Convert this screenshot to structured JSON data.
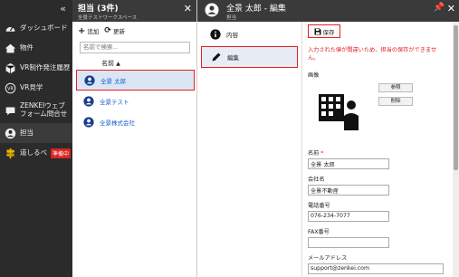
{
  "sidebar": {
    "collapse_glyph": "«",
    "items": [
      {
        "label": "ダッシュボード",
        "icon": "speedometer-icon"
      },
      {
        "label": "物件",
        "icon": "building-icon"
      },
      {
        "label": "VR制作発注履歴",
        "icon": "vr-headset-icon"
      },
      {
        "label": "VR見学",
        "icon": "vr-badge-icon"
      },
      {
        "label": "ZENKEIウェブ\nフォーム問合せ",
        "icon": "chat-icon"
      },
      {
        "label": "担当",
        "icon": "person-icon",
        "active": true
      },
      {
        "label": "道しるべ",
        "icon": "signpost-icon",
        "badge": "準備中"
      }
    ]
  },
  "list_panel": {
    "title": "担当 (3件)",
    "subtitle": "全景テストワークスペース",
    "add_label": "追加",
    "refresh_label": "更新",
    "search_placeholder": "名前で検索...",
    "column_header": "名前",
    "rows": [
      {
        "name": "全景 太郎",
        "selected": true
      },
      {
        "name": "全景テスト",
        "selected": false
      },
      {
        "name": "全景株式会社",
        "selected": false
      }
    ]
  },
  "detail": {
    "title": "全景 太郎 - 編集",
    "subtitle": "担当",
    "tabs": [
      {
        "label": "内容",
        "icon": "info-icon",
        "active": false
      },
      {
        "label": "編集",
        "icon": "pencil-icon",
        "active": true
      }
    ],
    "save_label": "保存",
    "validation_message": "入力された値が間違いため、担当の保存ができません。",
    "photo_label": "画像",
    "browse_label": "参照",
    "delete_label": "削除",
    "name_label": "名前",
    "name_required": "*",
    "name_value": "全景 太郎",
    "company_label": "会社名",
    "company_value": "全景不動産",
    "phone_label": "電話番号",
    "phone_value": "076-234-7077",
    "fax_label": "FAX番号",
    "fax_value": "",
    "email_label": "メールアドレス",
    "email_value": "support@zenkei.com"
  },
  "colors": {
    "sidebar_bg": "#2b2b2b",
    "header_bg": "#3a3a3a",
    "link": "#1a5fc7",
    "highlight": "#e02020",
    "selected_bg": "#dbe6f5"
  }
}
